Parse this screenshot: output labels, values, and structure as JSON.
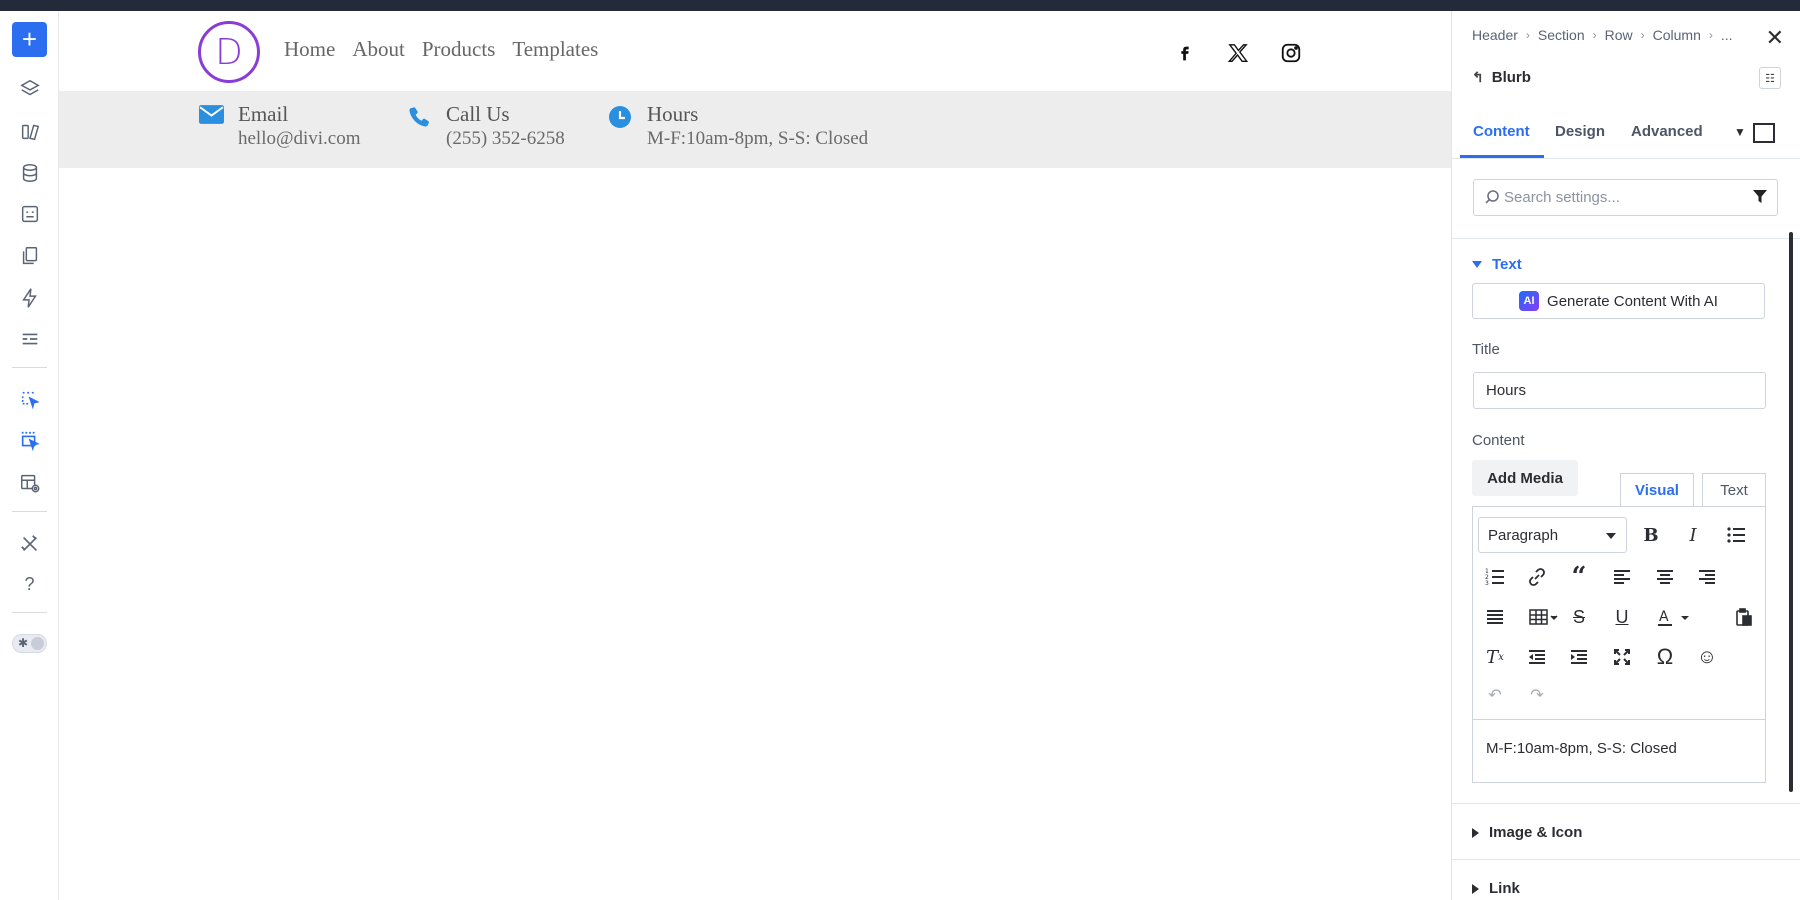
{
  "left_toolbar": {
    "add_label": "+",
    "icons": [
      "layers-icon",
      "modules-icon",
      "database-icon",
      "forms-icon",
      "pages-icon",
      "lightning-icon",
      "list-icon",
      "select-icon",
      "multi-select-icon",
      "template-preview-icon",
      "tools-icon",
      "help-icon"
    ],
    "help_label": "?"
  },
  "site_header": {
    "logo_letter": "D",
    "nav": [
      "Home",
      "About",
      "Products",
      "Templates"
    ],
    "social_icons": [
      "facebook-icon",
      "x-twitter-icon",
      "instagram-icon"
    ]
  },
  "info_bar": {
    "blurbs": [
      {
        "icon": "envelope-icon",
        "title": "Email",
        "content": "hello@divi.com"
      },
      {
        "icon": "phone-icon",
        "title": "Call Us",
        "content": "(255) 352-6258"
      },
      {
        "icon": "clock-icon",
        "title": "Hours",
        "content": "M-F:10am-8pm, S-S: Closed"
      }
    ],
    "accent_color": "#2b8fe0"
  },
  "panel": {
    "breadcrumbs": [
      "Header",
      "Section",
      "Row",
      "Column",
      "..."
    ],
    "module_name": "Blurb",
    "tabs": [
      "Content",
      "Design",
      "Advanced"
    ],
    "search_placeholder": "Search settings...",
    "text_section": "Text",
    "ai_button": "Generate Content With AI",
    "ai_badge": "AI",
    "title_label": "Title",
    "title_value": "Hours",
    "content_label": "Content",
    "add_media": "Add Media",
    "editor_tabs": [
      "Visual",
      "Text"
    ],
    "paragraph_select": "Paragraph",
    "editor_text": "M-F:10am-8pm, S-S: Closed",
    "collapsed_sections": [
      "Image & Icon",
      "Link"
    ],
    "accent_color": "#2b6ff0"
  }
}
